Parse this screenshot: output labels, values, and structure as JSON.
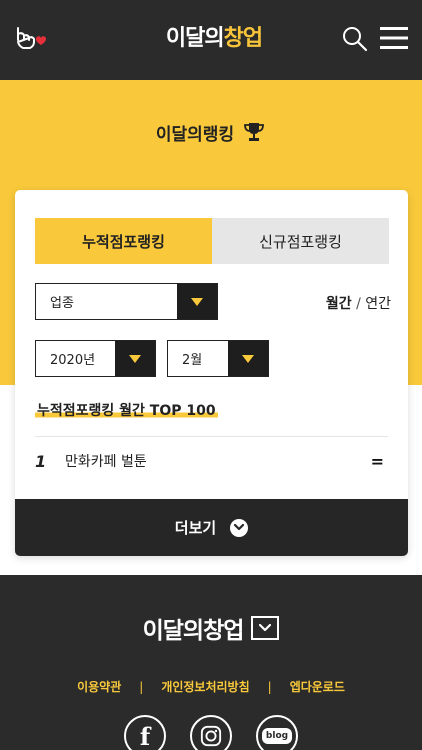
{
  "header": {
    "logo_main": "이달의",
    "logo_accent": "창업"
  },
  "section": {
    "title": "이달의랭킹"
  },
  "tabs": [
    {
      "label": "누적점포랭킹",
      "active": true
    },
    {
      "label": "신규점포랭킹",
      "active": false
    }
  ],
  "filters": {
    "industry": "업종",
    "year": "2020년",
    "month": "2월"
  },
  "period": {
    "monthly": "월간",
    "separator": "/",
    "yearly": "연간"
  },
  "ranking": {
    "title": "누적점포랭킹 월간 TOP 100",
    "rows": [
      {
        "rank": "1",
        "name": "만화카페 벌툰",
        "change": "="
      }
    ]
  },
  "more_button": {
    "label": "더보기"
  },
  "footer": {
    "logo": "이달의창업",
    "links": [
      "이용약관",
      "개인정보처리방침",
      "엡다운로드"
    ],
    "separator": "|",
    "social": [
      {
        "icon": "facebook-icon",
        "glyph": "f"
      },
      {
        "icon": "instagram-icon"
      },
      {
        "icon": "blog-icon",
        "glyph": "blog"
      }
    ]
  },
  "colors": {
    "accent": "#f9c93b",
    "dark": "#2b2b2b",
    "brand_red": "#e8303a"
  }
}
